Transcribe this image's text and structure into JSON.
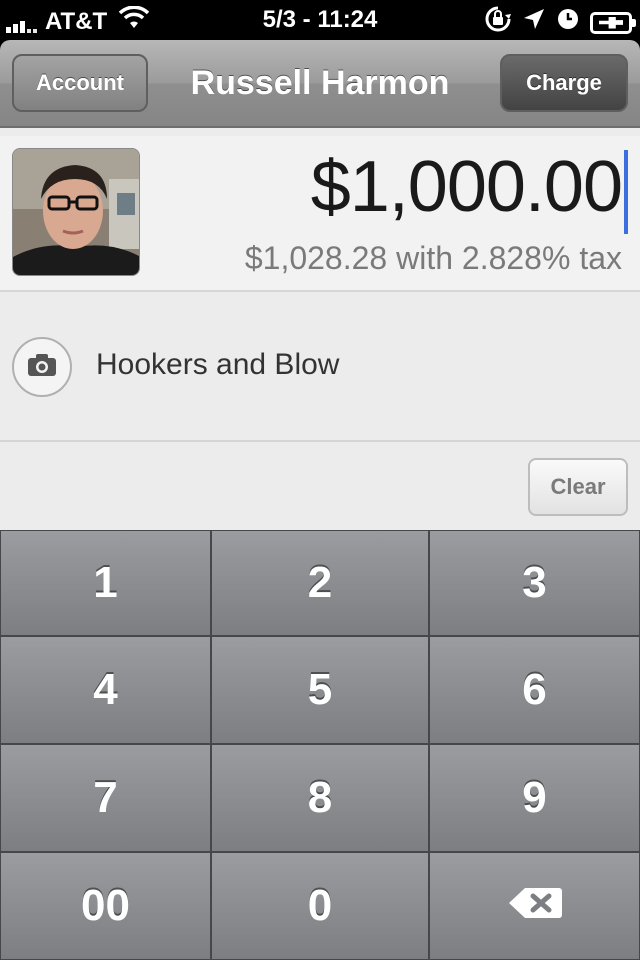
{
  "status_bar": {
    "carrier": "AT&T",
    "time": "5/3 - 11:24"
  },
  "nav": {
    "account_label": "Account",
    "title": "Russell Harmon",
    "charge_label": "Charge"
  },
  "payment": {
    "amount": "$1,000.00",
    "tax_line": "$1,028.28 with 2.828% tax"
  },
  "note": {
    "text": "Hookers and Blow"
  },
  "clear_label": "Clear",
  "keypad": {
    "keys": [
      "1",
      "2",
      "3",
      "4",
      "5",
      "6",
      "7",
      "8",
      "9",
      "00",
      "0"
    ]
  },
  "colors": {
    "cursor": "#3c6ee0",
    "charge_button": "#434343"
  },
  "icons": {
    "wifi": "wifi-icon",
    "rotation_lock": "rotation-lock-icon",
    "location": "location-icon",
    "alarm": "alarm-icon",
    "battery": "battery-icon",
    "camera": "camera-icon",
    "backspace": "backspace-icon"
  }
}
